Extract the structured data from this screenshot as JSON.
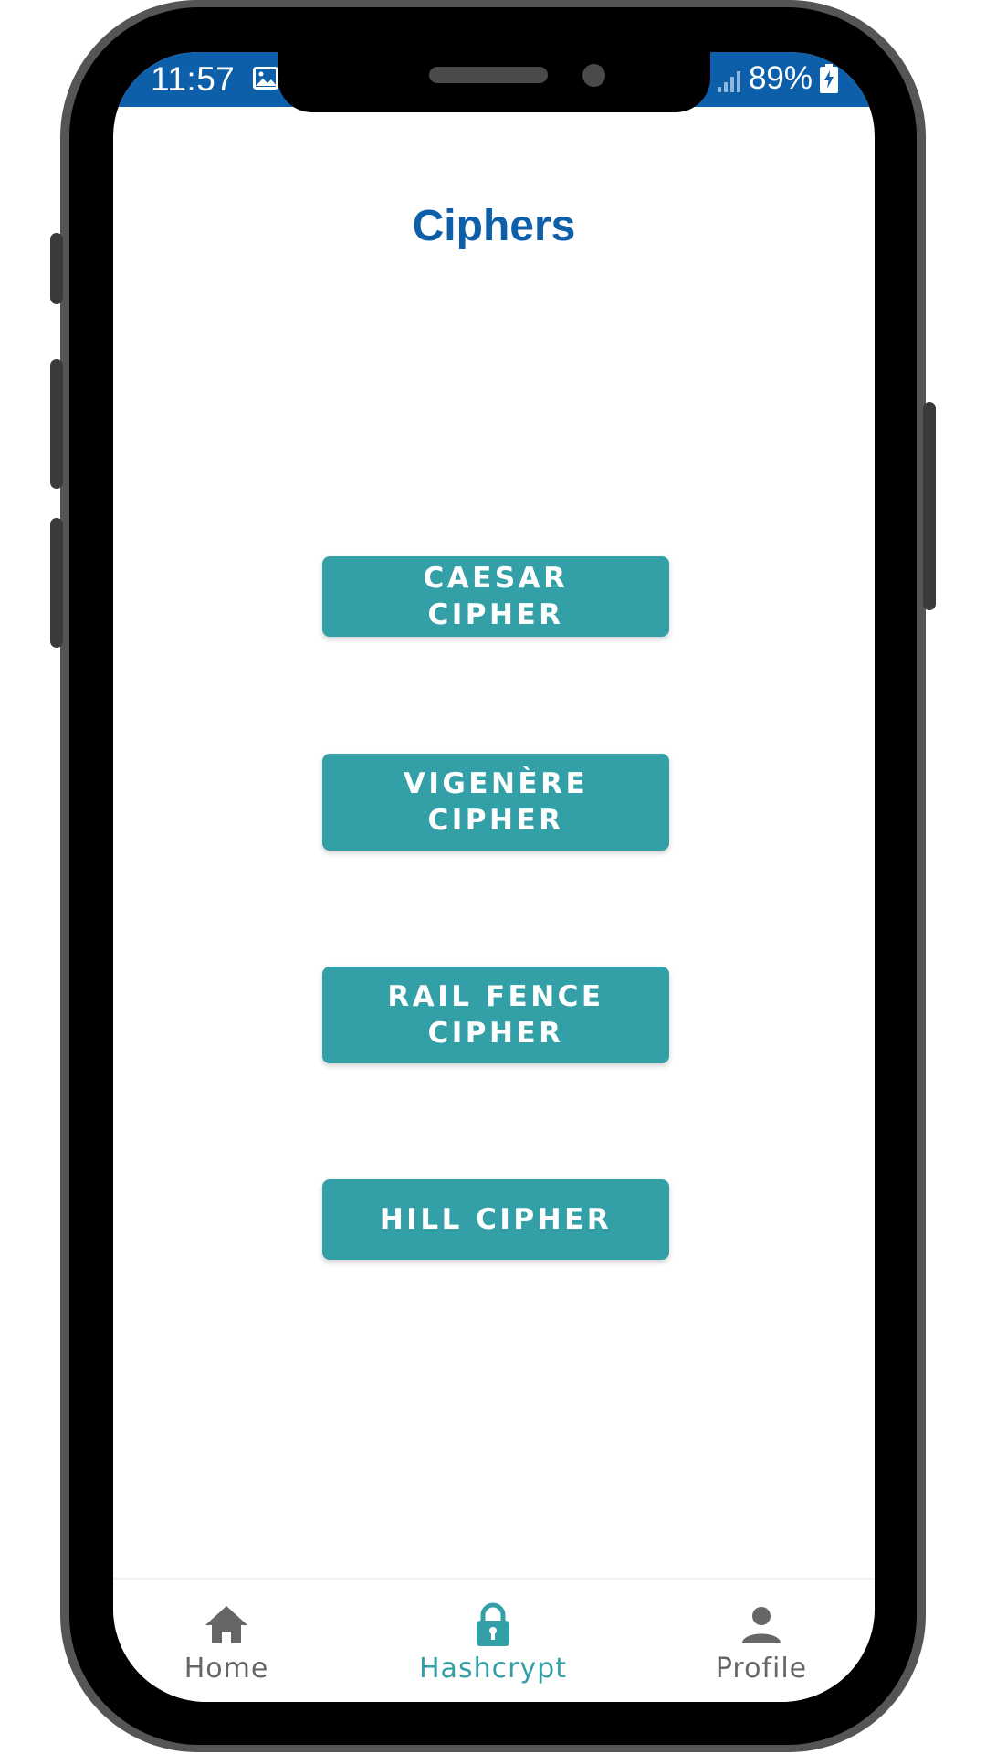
{
  "status_bar": {
    "time": "11:57",
    "battery": "89%",
    "gallery_icon": "image-icon",
    "signal_icon": "signal-icon",
    "battery_icon": "battery-charging-icon",
    "background_color": "#0c5fa8"
  },
  "page": {
    "title": "Ciphers",
    "title_color": "#0c5fa8"
  },
  "buttons": {
    "caesar": "CAESAR CIPHER",
    "vigenere": "VIGENÈRE CIPHER",
    "rail_fence": "RAIL FENCE CIPHER",
    "hill": "HILL CIPHER",
    "color": "#33a0a8"
  },
  "bottom_nav": {
    "items": [
      {
        "label": "Home",
        "icon": "home-icon",
        "active": false
      },
      {
        "label": "Hashcrypt",
        "icon": "lock-icon",
        "active": true
      },
      {
        "label": "Profile",
        "icon": "person-icon",
        "active": false
      }
    ],
    "active_color": "#33a0a8",
    "inactive_color": "#666666"
  }
}
